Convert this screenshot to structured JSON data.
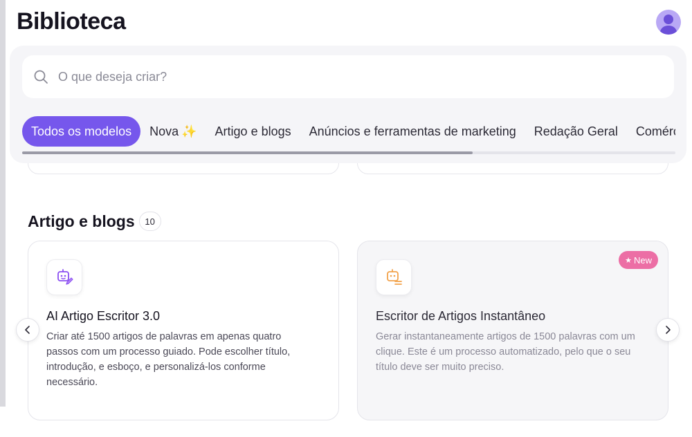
{
  "page": {
    "title": "Biblioteca"
  },
  "search": {
    "placeholder": "O que deseja criar?"
  },
  "tabs": [
    {
      "label": "Todos os modelos",
      "active": true
    },
    {
      "label": "Nova",
      "suffix": "✨"
    },
    {
      "label": "Artigo e blogs"
    },
    {
      "label": "Anúncios e ferramentas de marketing"
    },
    {
      "label": "Redação Geral"
    },
    {
      "label": "Comércio"
    }
  ],
  "tabs_scroll": {
    "visible_fraction": 0.69
  },
  "section": {
    "title": "Artigo e blogs",
    "count": "10"
  },
  "cards": [
    {
      "title": "AI Artigo Escritor 3.0",
      "description": "Criar até 1500 artigos de palavras em apenas quatro passos com um processo guiado. Pode escolher título, introdução, e esboço, e personalizá-los conforme necessário.",
      "icon": "robot-edit-icon",
      "icon_color": "#8b4ff2"
    },
    {
      "title": "Escritor de Artigos Instantâneo",
      "description": "Gerar instantaneamente artigos de 1500 palavras com um clique. Este é um processo automatizado, pelo que o seu título deve ser muito preciso.",
      "icon": "robot-list-icon",
      "icon_color": "#f2a24a",
      "badge": "New"
    }
  ],
  "colors": {
    "accent": "#7657ec",
    "badge_new": "#ec6ea5",
    "panel": "#f5f5f8"
  }
}
